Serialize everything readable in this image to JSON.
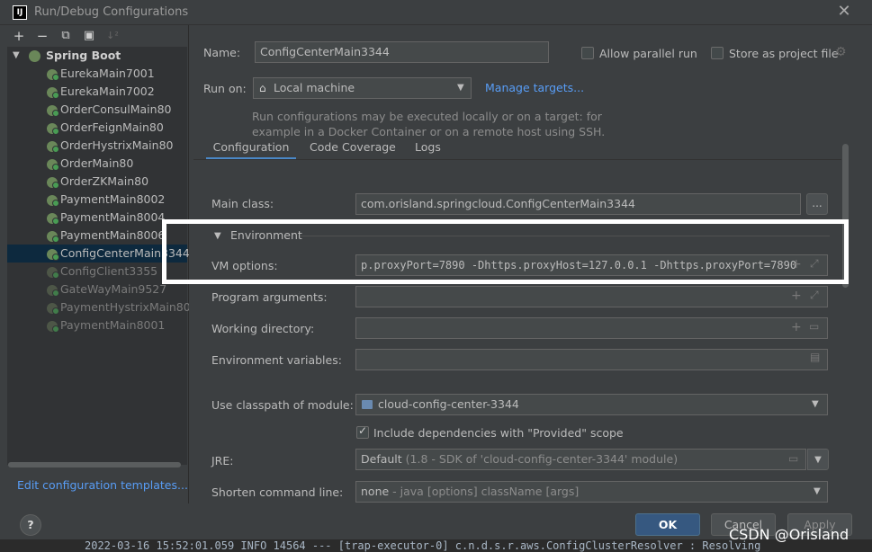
{
  "window": {
    "title": "Run/Debug Configurations"
  },
  "toolbar": {
    "add": "+",
    "remove": "−",
    "copy": "⧉",
    "folder": "▣",
    "sort": "↓²"
  },
  "tree": {
    "group": "Spring Boot",
    "items": [
      {
        "label": "EurekaMain7001",
        "dim": false
      },
      {
        "label": "EurekaMain7002",
        "dim": false
      },
      {
        "label": "OrderConsulMain80",
        "dim": false
      },
      {
        "label": "OrderFeignMain80",
        "dim": false
      },
      {
        "label": "OrderHystrixMain80",
        "dim": false
      },
      {
        "label": "OrderMain80",
        "dim": false
      },
      {
        "label": "OrderZKMain80",
        "dim": false
      },
      {
        "label": "PaymentMain8002",
        "dim": false
      },
      {
        "label": "PaymentMain8004",
        "dim": false
      },
      {
        "label": "PaymentMain8006",
        "dim": false
      },
      {
        "label": "ConfigCenterMain3344",
        "dim": false,
        "selected": true
      },
      {
        "label": "ConfigClient3355",
        "dim": true
      },
      {
        "label": "GateWayMain9527",
        "dim": true
      },
      {
        "label": "PaymentHystrixMain8001",
        "dim": true
      },
      {
        "label": "PaymentMain8001",
        "dim": true
      }
    ],
    "edit_templates": "Edit configuration templates..."
  },
  "form": {
    "name_label": "Name:",
    "name_value": "ConfigCenterMain3344",
    "allow_parallel": "Allow parallel run",
    "store_as_project": "Store as project file",
    "run_on_label": "Run on:",
    "run_on_value": "Local machine",
    "manage_targets": "Manage targets...",
    "hint_line1": "Run configurations may be executed locally or on a target: for",
    "hint_line2": "example in a Docker Container or on a remote host using SSH."
  },
  "tabs": [
    "Configuration",
    "Code Coverage",
    "Logs"
  ],
  "config": {
    "main_class_label": "Main class:",
    "main_class_value": "com.orisland.springcloud.ConfigCenterMain3344",
    "browse": "...",
    "environment_label": "Environment",
    "vm_options_label": "VM options:",
    "vm_options_value": "p.proxyPort=7890 -Dhttps.proxyHost=127.0.0.1 -Dhttps.proxyPort=7890",
    "program_args_label": "Program arguments:",
    "working_dir_label": "Working directory:",
    "env_vars_label": "Environment variables:",
    "classpath_label": "Use classpath of module:",
    "classpath_value": "cloud-config-center-3344",
    "include_deps": "Include dependencies with \"Provided\" scope",
    "jre_label": "JRE:",
    "jre_value": "Default",
    "jre_detail": "(1.8 - SDK of 'cloud-config-center-3344' module)",
    "shorten_label": "Shorten command line:",
    "shorten_value": "none",
    "shorten_detail": "- java [options] className [args]"
  },
  "buttons": {
    "help": "?",
    "ok": "OK",
    "cancel": "Cancel",
    "apply": "Apply"
  },
  "console_line": "2022-03-16 15:52:01.059  INFO 14564 --- [trap-executor-0] c.n.d.s.r.aws.ConfigClusterResolver      : Resolving",
  "watermark": "CSDN @Orisland",
  "colors": {
    "accent": "#589df6",
    "selection": "#0d293e",
    "ok_button": "#365880",
    "highlight_box": "#ffffff"
  }
}
